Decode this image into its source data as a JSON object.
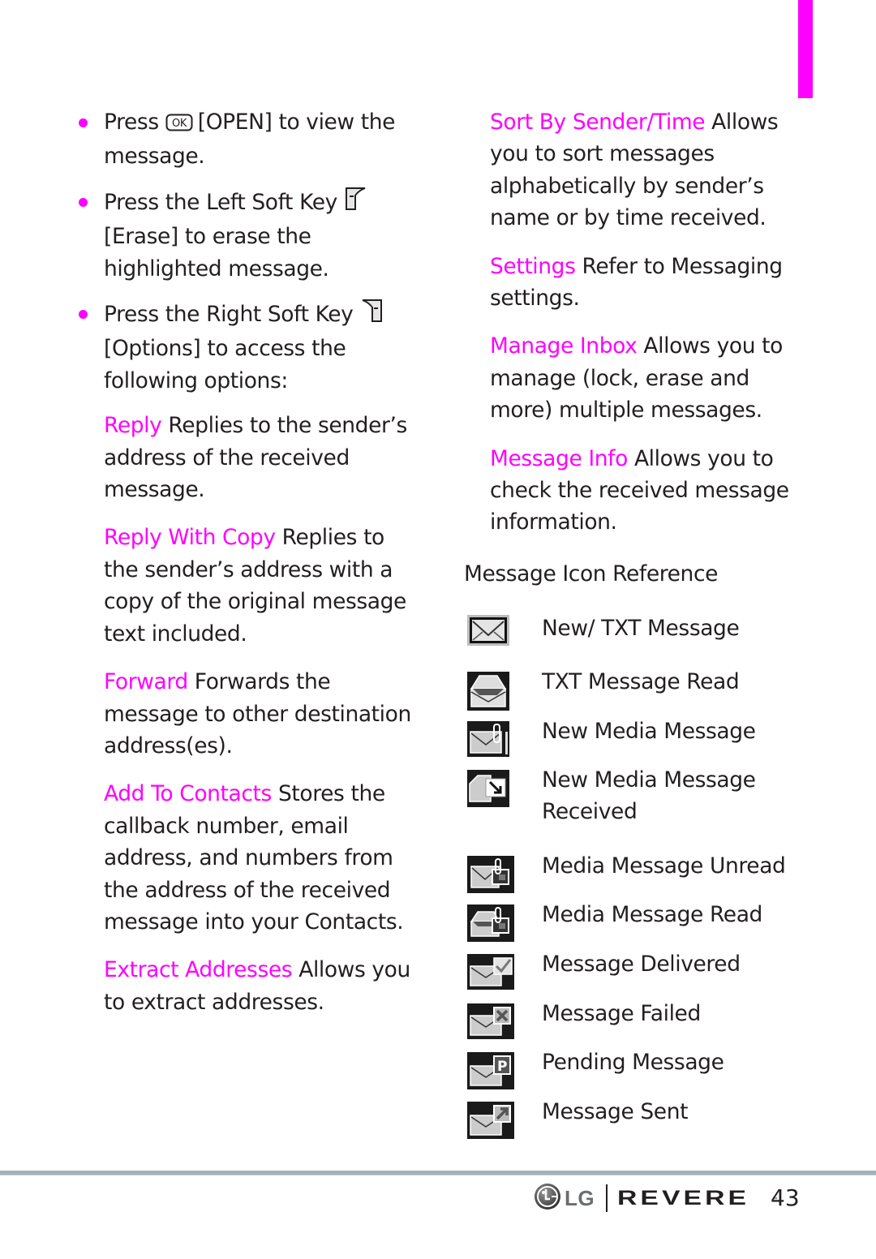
{
  "left_column": {
    "bullets": [
      {
        "pre": "Press",
        "key_icon": "ok-key-icon",
        "strong": "[OPEN]",
        "post": " to view the message."
      },
      {
        "pre": "Press the Left Soft Key",
        "key_icon": "left-soft-key-icon",
        "strong": "[Erase]",
        "post": " to erase the highlighted message."
      },
      {
        "pre": "Press the Right Soft Key",
        "key_icon": "right-soft-key-icon",
        "strong": "[Options]",
        "post": " to access the following options:"
      }
    ],
    "options": [
      {
        "term": "Reply",
        "desc": " Replies to the sender’s address of the received message."
      },
      {
        "term": "Reply With Copy",
        "desc": " Replies to the sender’s address with a copy of the original message text included."
      },
      {
        "term": "Forward",
        "desc": " Forwards the message to other destination address(es)."
      },
      {
        "term": "Add To Contacts",
        "desc": " Stores the callback number, email address, and numbers from the address of the received message into your Contacts."
      },
      {
        "term": "Extract Addresses",
        "desc": " Allows you to extract addresses."
      }
    ]
  },
  "right_column": {
    "options": [
      {
        "term": "Sort By Sender/Time",
        "desc": " Allows you to sort messages alphabetically by sender’s name or by time received."
      },
      {
        "term": "Settings",
        "desc": " Refer to Messaging settings."
      },
      {
        "term": "Manage Inbox",
        "desc": " Allows you to manage (lock, erase and more) multiple messages."
      },
      {
        "term": "Message Info",
        "desc": " Allows you to check the received message information."
      }
    ],
    "icon_reference": {
      "title": "Message Icon Reference",
      "items": [
        {
          "icon": "new-txt-message-icon",
          "label": "New/ TXT Message"
        },
        {
          "icon": "txt-message-read-icon",
          "label": "TXT Message Read"
        },
        {
          "icon": "new-media-message-icon",
          "label": "New Media Message"
        },
        {
          "icon": "new-media-message-received-icon",
          "label": "New Media Message Received"
        },
        {
          "icon": "media-message-unread-icon",
          "label": "Media Message Unread"
        },
        {
          "icon": "media-message-read-icon",
          "label": "Media Message Read"
        },
        {
          "icon": "message-delivered-icon",
          "label": "Message Delivered"
        },
        {
          "icon": "message-failed-icon",
          "label": "Message Failed"
        },
        {
          "icon": "pending-message-icon",
          "label": "Pending Message"
        },
        {
          "icon": "message-sent-icon",
          "label": "Message Sent"
        }
      ]
    }
  },
  "footer": {
    "brand": "LG",
    "product": "REVERE",
    "trademark": "™",
    "page_number": "43"
  },
  "colors": {
    "accent": "#ff00ff",
    "text": "#231f20",
    "footer_rule": "#a3b4b8"
  }
}
